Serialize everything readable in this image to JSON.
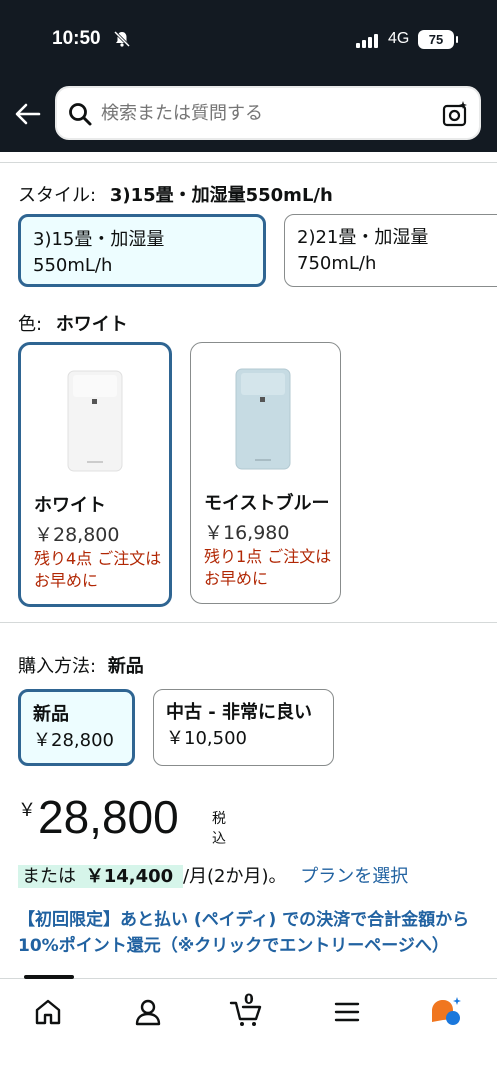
{
  "status_bar": {
    "time": "10:50",
    "network": "4G",
    "battery": "75"
  },
  "search": {
    "placeholder": "検索または質問する"
  },
  "style_section": {
    "label": "スタイル:",
    "selected_value": "3)15畳・加湿量550mL/h",
    "options": [
      {
        "line1": "3)15畳・加湿量",
        "line2": "550mL/h",
        "selected": true
      },
      {
        "line1": "2)21畳・加湿量",
        "line2": "750mL/h",
        "selected": false
      }
    ]
  },
  "color_section": {
    "label": "色:",
    "selected_value": "ホワイト",
    "options": [
      {
        "name": "ホワイト",
        "price": "￥28,800",
        "stock": "残り4点 ご注文はお早めに",
        "selected": true,
        "product_color": "#f3f3f3"
      },
      {
        "name": "モイストブルー",
        "price": "￥16,980",
        "stock": "残り1点 ご注文はお早めに",
        "selected": false,
        "product_color": "#c6dbe3"
      }
    ]
  },
  "purchase_section": {
    "label": "購入方法:",
    "selected_value": "新品",
    "options": [
      {
        "title": "新品",
        "price": "￥28,800",
        "selected": true
      },
      {
        "title": "中古 - 非常に良い",
        "price": "￥10,500",
        "selected": false
      }
    ]
  },
  "price": {
    "currency": "￥",
    "amount": "28,800",
    "tax_label": "税込"
  },
  "installment": {
    "prefix": "または",
    "amount": "￥14,400",
    "suffix": "/月(2か月)。",
    "link": "プランを選択"
  },
  "promo_text": "【初回限定】あと払い (ペイディ) での決済で合計金額から10%ポイント還元（※クリックでエントリーページへ）",
  "bottom_nav": {
    "cart_count": "0"
  },
  "colors": {
    "header_bg": "#131a22",
    "selected_border": "#2f6592",
    "link": "#2162a1",
    "stock_red": "#b12704",
    "installment_highlight": "#d6f5ea"
  }
}
